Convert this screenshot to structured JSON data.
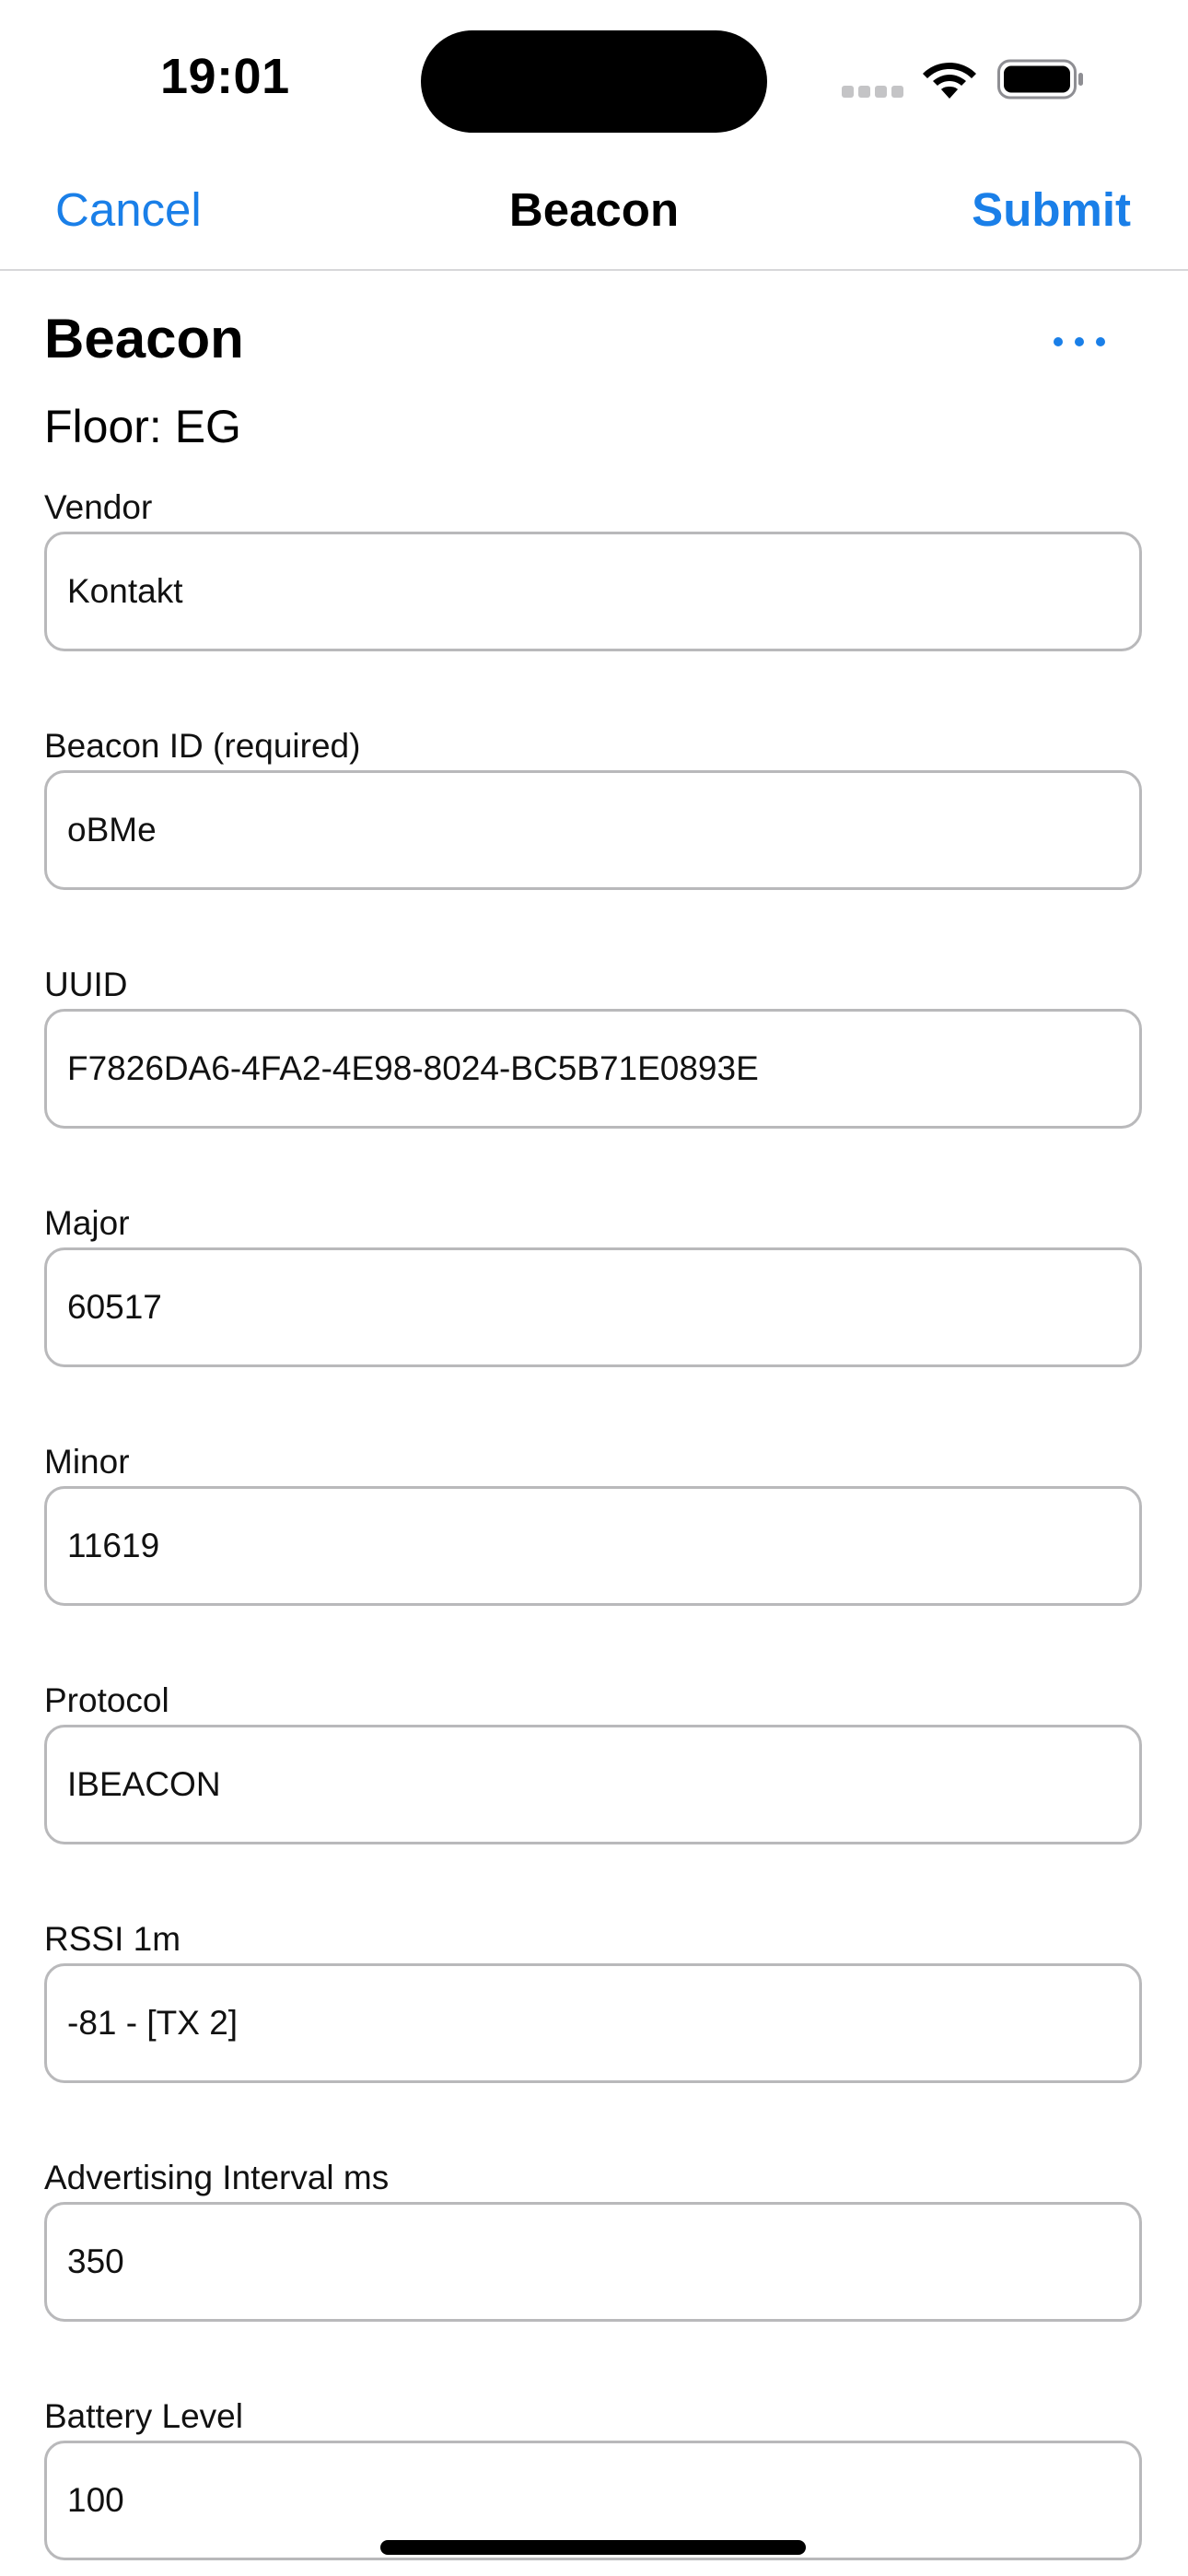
{
  "status_bar": {
    "time": "19:01",
    "icons": [
      "cellular-signal-icon",
      "wifi-icon",
      "battery-icon"
    ]
  },
  "nav": {
    "cancel_label": "Cancel",
    "title": "Beacon",
    "submit_label": "Submit"
  },
  "header": {
    "title": "Beacon",
    "more_icon": "ellipsis-icon",
    "floor": "Floor: EG"
  },
  "fields": [
    {
      "label": "Vendor",
      "value": "Kontakt"
    },
    {
      "label": "Beacon ID (required)",
      "value": "oBMe"
    },
    {
      "label": "UUID",
      "value": "F7826DA6-4FA2-4E98-8024-BC5B71E0893E"
    },
    {
      "label": "Major",
      "value": "60517"
    },
    {
      "label": "Minor",
      "value": "11619"
    },
    {
      "label": "Protocol",
      "value": "IBEACON"
    },
    {
      "label": "RSSI 1m",
      "value": "-81 - [TX 2]"
    },
    {
      "label": "Advertising Interval ms",
      "value": "350"
    },
    {
      "label": "Battery Level",
      "value": "100"
    }
  ],
  "colors": {
    "accent": "#1a7fe8",
    "border": "#b9b9bb",
    "divider": "#d7d7d9"
  }
}
